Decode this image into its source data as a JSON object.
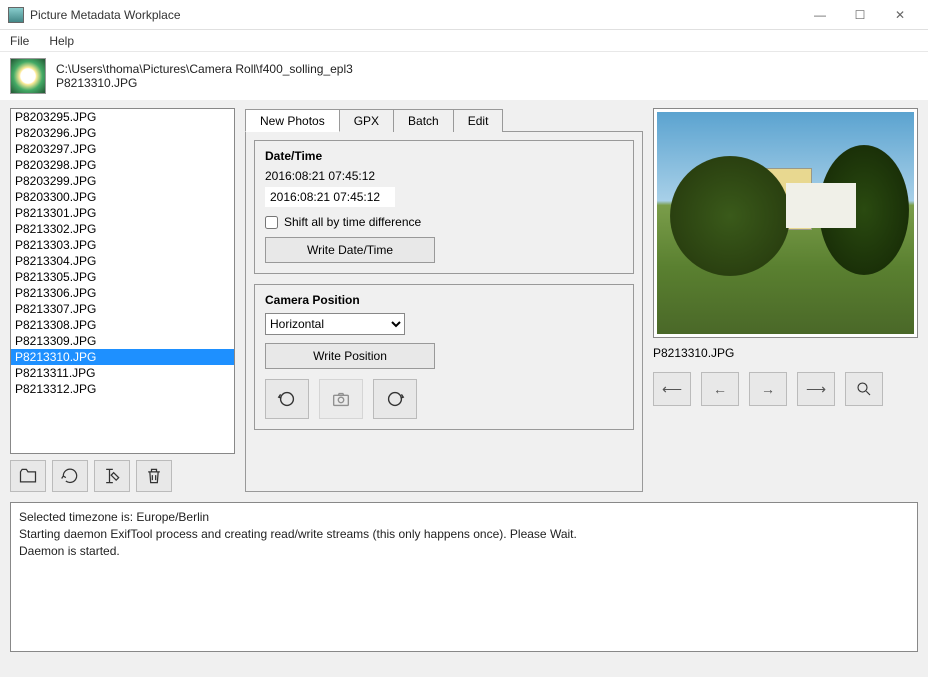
{
  "window": {
    "title": "Picture Metadata Workplace",
    "controls": {
      "minimize": "—",
      "maximize": "☐",
      "close": "✕"
    }
  },
  "menu": {
    "file": "File",
    "help": "Help"
  },
  "path": {
    "dir": "C:\\Users\\thoma\\Pictures\\Camera Roll\\f400_solling_epl3",
    "file": "P8213310.JPG"
  },
  "files": [
    "P8203295.JPG",
    "P8203296.JPG",
    "P8203297.JPG",
    "P8203298.JPG",
    "P8203299.JPG",
    "P8203300.JPG",
    "P8213301.JPG",
    "P8213302.JPG",
    "P8213303.JPG",
    "P8213304.JPG",
    "P8213305.JPG",
    "P8213306.JPG",
    "P8213307.JPG",
    "P8213308.JPG",
    "P8213309.JPG",
    "P8213310.JPG",
    "P8213311.JPG",
    "P8213312.JPG"
  ],
  "selected_file_index": 15,
  "tabs": {
    "newphotos": "New Photos",
    "gpx": "GPX",
    "batch": "Batch",
    "edit": "Edit"
  },
  "datetime": {
    "group_label": "Date/Time",
    "original": "2016:08:21 07:45:12",
    "editable": "2016:08:21 07:45:12",
    "shift_label": "Shift all by time difference",
    "write_button": "Write Date/Time"
  },
  "camerapos": {
    "group_label": "Camera Position",
    "selected": "Horizontal",
    "write_button": "Write Position"
  },
  "preview": {
    "filename": "P8213310.JPG"
  },
  "nav": {
    "first": "⟵",
    "prev": "←",
    "next": "→",
    "last": "⟶"
  },
  "log": [
    "Selected timezone is: Europe/Berlin",
    "Starting daemon ExifTool process and creating read/write streams (this only happens once). Please Wait.",
    "Daemon is started."
  ]
}
